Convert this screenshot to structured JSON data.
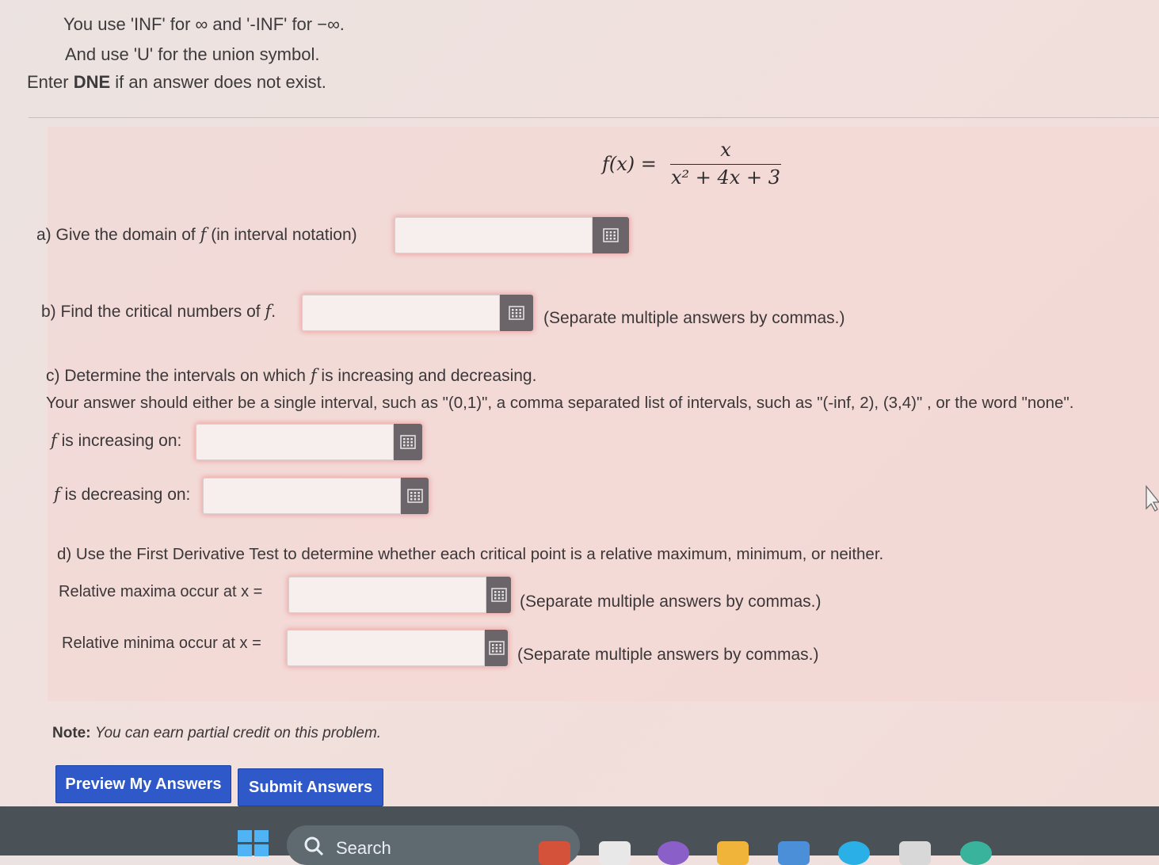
{
  "instructions": {
    "line1": "You use 'INF' for ∞ and '-INF' for −∞.",
    "line2": "And use 'U' for the union symbol.",
    "line3_pre": "Enter ",
    "line3_bold": "DNE",
    "line3_post": " if an answer does not exist."
  },
  "formula": {
    "lhs": "f(x) =",
    "numerator": "x",
    "denominator": "x² + 4x + 3"
  },
  "part_a": {
    "label_pre": "a) Give the domain of ",
    "label_var": "f",
    "label_post": " (in interval notation)",
    "value": ""
  },
  "part_b": {
    "label_pre": "b) Find the critical numbers of ",
    "label_var": "f",
    "label_post": ".",
    "value": "",
    "hint": "(Separate multiple answers by commas.)"
  },
  "part_c": {
    "prompt_pre": "c) Determine the intervals on which ",
    "prompt_var": "f",
    "prompt_post": " is increasing and decreasing.",
    "instructions": "Your answer should either be a single interval, such as \"(0,1)\", a comma separated list of intervals, such as \"(-inf, 2), (3,4)\" , or the word \"none\".",
    "increasing_label": "is increasing on:",
    "decreasing_label": "is decreasing on:",
    "var": "f",
    "increasing_value": "",
    "decreasing_value": ""
  },
  "part_d": {
    "prompt": "d) Use the First Derivative Test to determine whether each critical point is a relative maximum, minimum, or neither.",
    "maxima_label": "Relative maxima occur at x =",
    "minima_label": "Relative minima occur at x =",
    "maxima_value": "",
    "minima_value": "",
    "hint": "(Separate multiple answers by commas.)"
  },
  "note": {
    "bold": "Note:",
    "text": "You can earn partial credit on this problem."
  },
  "buttons": {
    "preview": "Preview My Answers",
    "submit": "Submit Answers"
  },
  "taskbar": {
    "search_label": "Search"
  },
  "icons": {
    "equation_editor": "equation-editor-icon",
    "windows": "windows-start-icon",
    "search": "search-icon",
    "cursor": "mouse-pointer-icon"
  },
  "colors": {
    "button_blue": "#2f58c8",
    "editor_button": "#6b6468",
    "field_glow": "#eb7878"
  }
}
